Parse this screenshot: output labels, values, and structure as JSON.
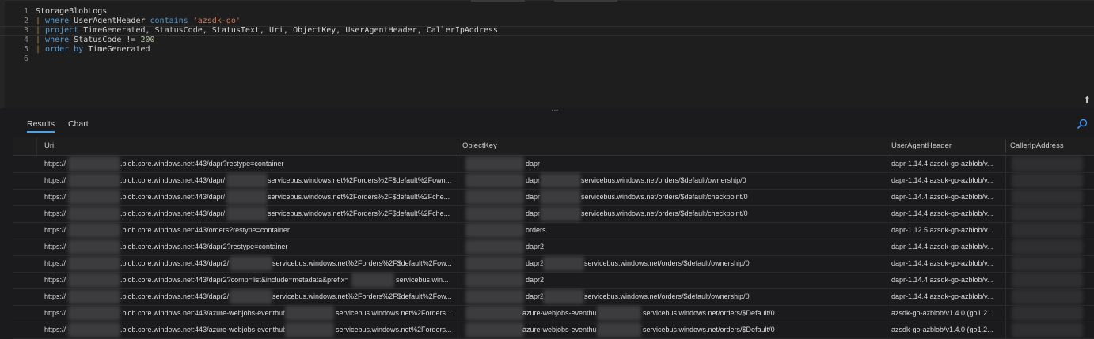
{
  "query": {
    "lines": [
      {
        "n": "1",
        "tokens": [
          {
            "t": "StorageBlobLogs",
            "c": "ident"
          }
        ]
      },
      {
        "n": "2",
        "tokens": [
          {
            "t": "| ",
            "c": "pipe"
          },
          {
            "t": "where",
            "c": "kw"
          },
          {
            "t": " UserAgentHeader ",
            "c": "ident"
          },
          {
            "t": "contains",
            "c": "kw"
          },
          {
            "t": " ",
            "c": "ident"
          },
          {
            "t": "'azsdk-go'",
            "c": "str"
          }
        ]
      },
      {
        "n": "3",
        "tokens": [
          {
            "t": "| ",
            "c": "pipe"
          },
          {
            "t": "project",
            "c": "kw"
          },
          {
            "t": " TimeGenerated, StatusCode, StatusText, Uri, ObjectKey, UserAgentHeader, CallerIpAddress",
            "c": "ident"
          }
        ]
      },
      {
        "n": "4",
        "tokens": [
          {
            "t": "| ",
            "c": "pipe"
          },
          {
            "t": "where",
            "c": "kw"
          },
          {
            "t": " StatusCode != ",
            "c": "ident"
          },
          {
            "t": "200",
            "c": "num"
          }
        ]
      },
      {
        "n": "5",
        "tokens": [
          {
            "t": "| ",
            "c": "pipe"
          },
          {
            "t": "order by",
            "c": "kw"
          },
          {
            "t": " TimeGenerated",
            "c": "ident"
          }
        ]
      },
      {
        "n": "6",
        "tokens": []
      }
    ]
  },
  "splitter": {
    "grip": "…"
  },
  "editor": {
    "collapse_glyph": "⬆"
  },
  "results": {
    "tabs": [
      {
        "label": "Results",
        "active": true
      },
      {
        "label": "Chart",
        "active": false
      }
    ],
    "columns": [
      "Uri",
      "ObjectKey",
      "UserAgentHeader",
      "CallerIpAddress"
    ],
    "rows": [
      {
        "uri_a": "https://",
        "uri_b": ".blob.core.windows.net:443/dapr?restype=container",
        "uri_c": "",
        "key_a": "dapr",
        "key_b": "",
        "ua": "dapr-1.14.4 azsdk-go-azblob/v..."
      },
      {
        "uri_a": "https://",
        "uri_b": ".blob.core.windows.net:443/dapr/",
        "uri_c": "servicebus.windows.net%2Forders%2F$default%2Fown...",
        "key_a": "dapr/",
        "key_b": "servicebus.windows.net/orders/$default/ownership/0",
        "ua": "dapr-1.14.4 azsdk-go-azblob/v..."
      },
      {
        "uri_a": "https://",
        "uri_b": ".blob.core.windows.net:443/dapr/",
        "uri_c": "servicebus.windows.net%2Forders%2F$default%2Fche...",
        "key_a": "dapr/",
        "key_b": "servicebus.windows.net/orders/$default/checkpoint/0",
        "ua": "dapr-1.14.4 azsdk-go-azblob/v..."
      },
      {
        "uri_a": "https://",
        "uri_b": ".blob.core.windows.net:443/dapr/",
        "uri_c": "servicebus.windows.net%2Forders%2F$default%2Fche...",
        "key_a": "dapr/",
        "key_b": "servicebus.windows.net/orders/$default/checkpoint/0",
        "ua": "dapr-1.14.4 azsdk-go-azblob/v..."
      },
      {
        "uri_a": "https://",
        "uri_b": ".blob.core.windows.net:443/orders?restype=container",
        "uri_c": "",
        "key_a": "orders",
        "key_b": "",
        "ua": "dapr-1.12.5 azsdk-go-azblob/v..."
      },
      {
        "uri_a": "https://",
        "uri_b": ".blob.core.windows.net:443/dapr2?restype=container",
        "uri_c": "",
        "key_a": "dapr2",
        "key_b": "",
        "ua": "dapr-1.14.4 azsdk-go-azblob/v..."
      },
      {
        "uri_a": "https://",
        "uri_b": ".blob.core.windows.net:443/dapr2/",
        "uri_c": "servicebus.windows.net%2Forders%2F$default%2Fow...",
        "key_a": "dapr2/",
        "key_b": "servicebus.windows.net/orders/$default/ownership/0",
        "ua": "dapr-1.14.4 azsdk-go-azblob/v..."
      },
      {
        "uri_a": "https://",
        "uri_b": ".blob.core.windows.net:443/dapr2?comp=list&include=metadata&prefix=",
        "uri_c": "servicebus.win...",
        "key_a": "dapr2",
        "key_b": "",
        "ua": "dapr-1.14.4 azsdk-go-azblob/v..."
      },
      {
        "uri_a": "https://",
        "uri_b": ".blob.core.windows.net:443/dapr2/",
        "uri_c": "servicebus.windows.net%2Forders%2F$default%2Fow...",
        "key_a": "dapr2/",
        "key_b": "servicebus.windows.net/orders/$default/ownership/0",
        "ua": "dapr-1.14.4 azsdk-go-azblob/v..."
      },
      {
        "uri_a": "https://",
        "uri_b": ".blob.core.windows.net:443/azure-webjobs-eventhub",
        "uri_c": "servicebus.windows.net%2Forders...",
        "key_a": "azure-webjobs-eventhu",
        "key_b": "servicebus.windows.net/orders/$Default/0",
        "ua": "azsdk-go-azblob/v1.4.0 (go1.2..."
      },
      {
        "uri_a": "https://",
        "uri_b": ".blob.core.windows.net:443/azure-webjobs-eventhub",
        "uri_c": "servicebus.windows.net%2Forders...",
        "key_a": "azure-webjobs-eventhu",
        "key_b": "servicebus.windows.net/orders/$Default/0",
        "ua": "azsdk-go-azblob/v1.4.0 (go1.2..."
      }
    ]
  }
}
